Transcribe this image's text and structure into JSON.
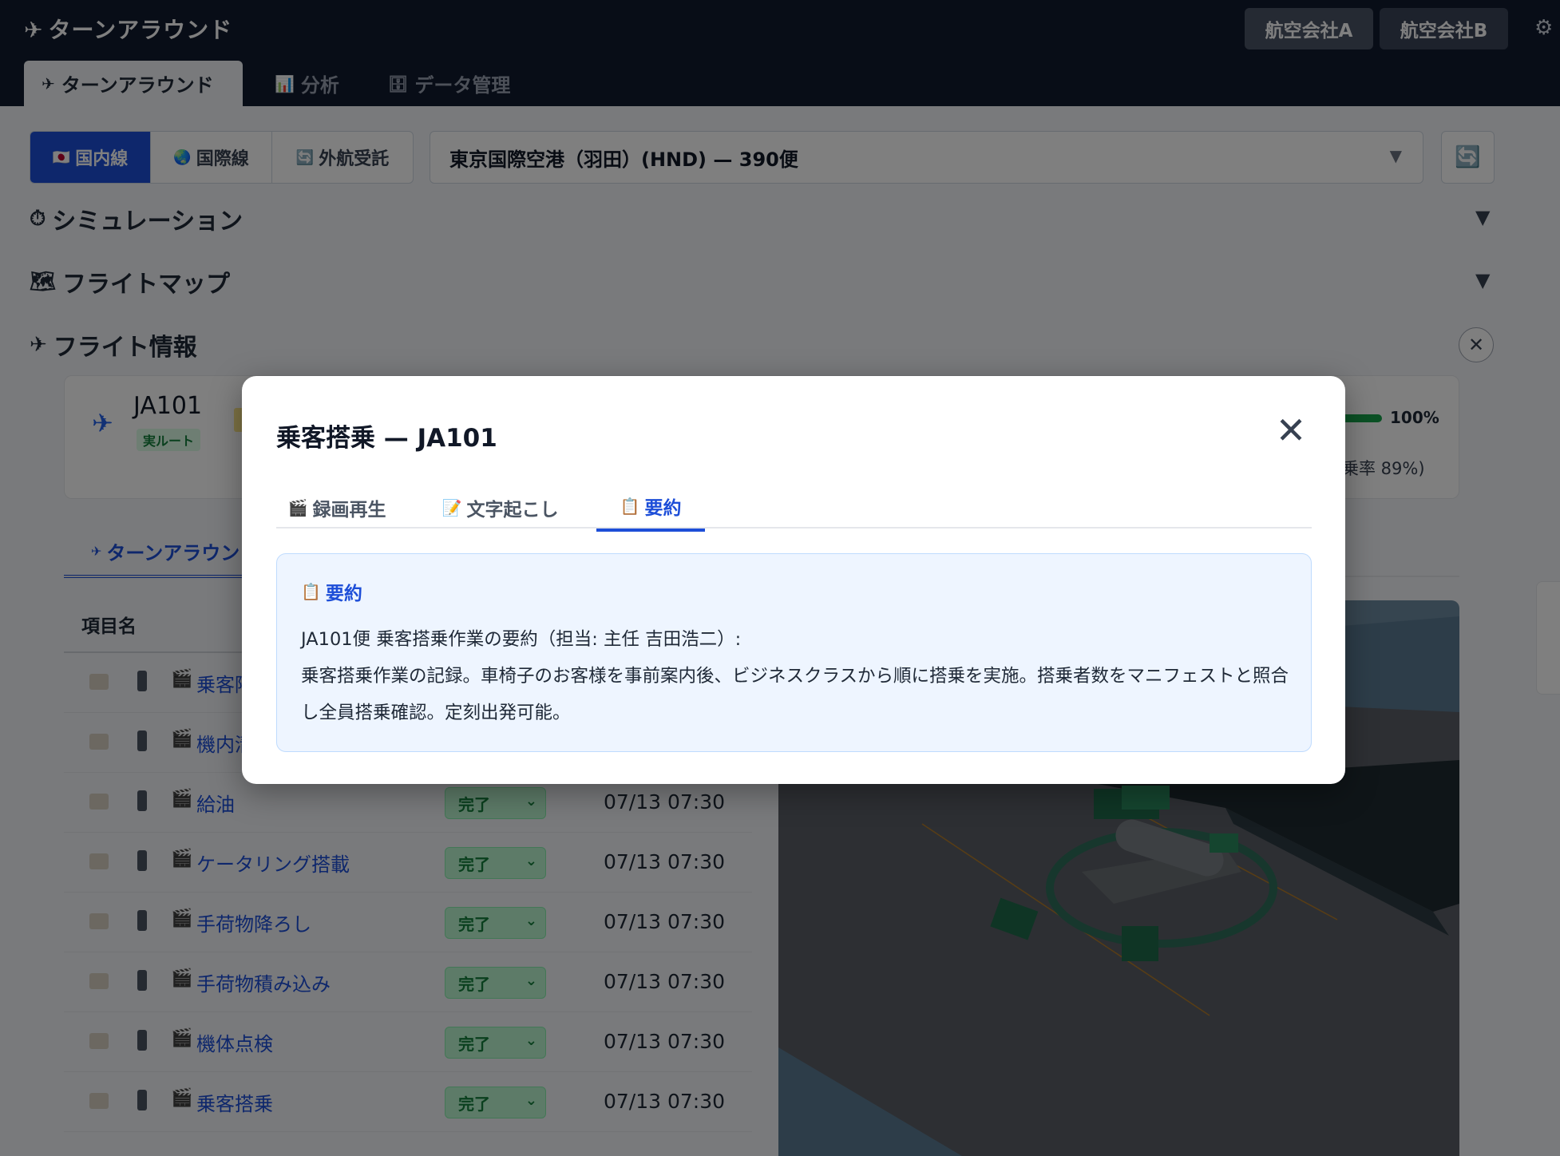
{
  "header": {
    "app_title": "ターンアラウンド",
    "airlines": [
      "航空会社A",
      "航空会社B"
    ],
    "settings_icon": "gear-icon"
  },
  "main_tabs": [
    {
      "label": "ターンアラウンド",
      "icon": "✈",
      "active": true
    },
    {
      "label": "分析",
      "icon": "📊",
      "active": false
    },
    {
      "label": "データ管理",
      "icon": "🗄",
      "active": false
    }
  ],
  "filter": {
    "segments": [
      {
        "label": "国内線",
        "icon": "🇯🇵",
        "active": true
      },
      {
        "label": "国際線",
        "icon": "🌏",
        "active": false
      },
      {
        "label": "外航受託",
        "icon": "🔄",
        "active": false
      }
    ],
    "airport_value": "東京国際空港（羽田）(HND) — 390便"
  },
  "sections": {
    "simulation": {
      "label": "シミュレーション",
      "icon": "⏱"
    },
    "flight_map": {
      "label": "フライトマップ",
      "icon": "🗺"
    },
    "flight_info": {
      "label": "フライト情報",
      "icon": "✈"
    }
  },
  "flight_card": {
    "registration": "JA101",
    "route_badge": "実ルート",
    "progress_percent": "100%",
    "progress_value": 1.0,
    "load_text": "乗率 89%)"
  },
  "sub_tab": {
    "label": "ターンアラウン",
    "icon": "✈"
  },
  "table": {
    "header_name": "項目名",
    "rows": [
      {
        "name": "乗客降",
        "status": "",
        "time": ""
      },
      {
        "name": "機内清",
        "status": "",
        "time": ""
      },
      {
        "name": "給油",
        "status": "完了",
        "time": "07/13 07:30"
      },
      {
        "name": "ケータリング搭載",
        "status": "完了",
        "time": "07/13 07:30"
      },
      {
        "name": "手荷物降ろし",
        "status": "完了",
        "time": "07/13 07:30"
      },
      {
        "name": "手荷物積み込み",
        "status": "完了",
        "time": "07/13 07:30"
      },
      {
        "name": "機体点検",
        "status": "完了",
        "time": "07/13 07:30"
      },
      {
        "name": "乗客搭乗",
        "status": "完了",
        "time": "07/13 07:30"
      }
    ]
  },
  "modal": {
    "title": "乗客搭乗 — JA101",
    "tabs": [
      {
        "label": "録画再生",
        "icon": "🎬",
        "active": false
      },
      {
        "label": "文字起こし",
        "icon": "📝",
        "active": false
      },
      {
        "label": "要約",
        "icon": "📋",
        "active": true
      }
    ],
    "summary_heading": "要約",
    "summary_lines": [
      "JA101便 乗客搭乗作業の要約（担当: 主任 吉田浩二）:",
      "乗客搭乗作業の記録。車椅子のお客様を事前案内後、ビジネスクラスから順に搭乗を実施。搭乗者数をマニフェストと照合し全員搭乗確認。定刻出発可能。"
    ]
  }
}
